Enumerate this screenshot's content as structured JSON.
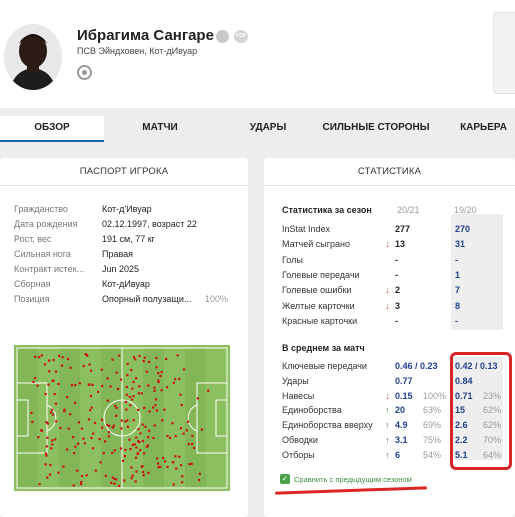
{
  "player": {
    "name": "Ибрагима Сангаре",
    "club": "ПСВ Эйндховен,  Кот-дИвуар",
    "pdf_label": "PDF"
  },
  "tabs": [
    {
      "label": "ОБЗОР",
      "active": true
    },
    {
      "label": "МАТЧИ",
      "active": false
    },
    {
      "label": "УДАРЫ",
      "active": false
    },
    {
      "label": "СИЛЬНЫЕ СТОРОНЫ",
      "active": false
    },
    {
      "label": "КАРЬЕРА",
      "active": false
    }
  ],
  "passport": {
    "title": "ПАСПОРТ ИГРОКА",
    "rows": [
      {
        "label": "Гражданство",
        "value": "Кот-д'Ивуар",
        "extra": ""
      },
      {
        "label": "Дата рождения",
        "value": "02.12.1997, возраст 22",
        "extra": ""
      },
      {
        "label": "Рост, вес",
        "value": "191 см, 77 кг",
        "extra": ""
      },
      {
        "label": "Сильная нога",
        "value": "Правая",
        "extra": ""
      },
      {
        "label": "Контракт истек...",
        "value": "Jun 2025",
        "extra": ""
      },
      {
        "label": "Сборная",
        "value": "Кот-дИвуар",
        "extra": ""
      },
      {
        "label": "Позиция",
        "value": "Опорный полузащи...",
        "extra": "100%"
      }
    ],
    "pitch_colors": {
      "grass": "#8cbf5f",
      "grass_dark": "#82b656",
      "lines": "#ffffff",
      "dots": "#c81414"
    }
  },
  "stats": {
    "title": "СТАТИСТИКА",
    "season_title": "Статистика за сезон",
    "col1": "20/21",
    "col2": "19/20",
    "season_rows": [
      {
        "label": "InStat Index",
        "arrow": "",
        "v1": "277",
        "v2": "270"
      },
      {
        "label": "Матчей сыграно",
        "arrow": "↓",
        "v1": "13",
        "v2": "31"
      },
      {
        "label": "Голы",
        "arrow": "",
        "v1": "-",
        "v2": "-"
      },
      {
        "label": "Голевые передачи",
        "arrow": "",
        "v1": "-",
        "v2": "1"
      },
      {
        "label": "Голевые ошибки",
        "arrow": "↓",
        "v1": "2",
        "v2": "7"
      },
      {
        "label": "Желтые карточки",
        "arrow": "↓",
        "v1": "3",
        "v2": "8"
      },
      {
        "label": "Красные карточки",
        "arrow": "",
        "v1": "-",
        "v2": "-"
      }
    ],
    "avg_title": "В среднем за матч",
    "avg_rows": [
      {
        "label": "Ключевые передачи",
        "arrow": "",
        "v1": "0.46 / 0.23",
        "p1": "",
        "v2": "0.42 / 0.13",
        "p2": ""
      },
      {
        "label": "Удары",
        "arrow": "",
        "v1": "0.77",
        "p1": "",
        "v2": "0.84",
        "p2": ""
      },
      {
        "label": "Навесы",
        "arrow": "↓",
        "v1": "0.15",
        "p1": "100%",
        "v2": "0.71",
        "p2": "23%"
      },
      {
        "label": "Единоборства",
        "arrow": "↑",
        "v1": "20",
        "p1": "63%",
        "v2": "15",
        "p2": "62%"
      },
      {
        "label": "Единоборства вверху",
        "arrow": "↑",
        "v1": "4.9",
        "p1": "69%",
        "v2": "2.6",
        "p2": "62%"
      },
      {
        "label": "Обводки",
        "arrow": "↑",
        "v1": "3.1",
        "p1": "75%",
        "v2": "2.2",
        "p2": "70%"
      },
      {
        "label": "Отборы",
        "arrow": "↑",
        "v1": "6",
        "p1": "54%",
        "v2": "5.1",
        "p2": "64%"
      }
    ],
    "compare_label": "Сравнить с предыдущим сезоном",
    "compare_checked": true
  },
  "colors": {
    "accent": "#1e64a8",
    "value_blue": "#1f3f8f",
    "down": "#d03a2e",
    "up": "#3e8e3e",
    "highlight": "#d92525"
  }
}
